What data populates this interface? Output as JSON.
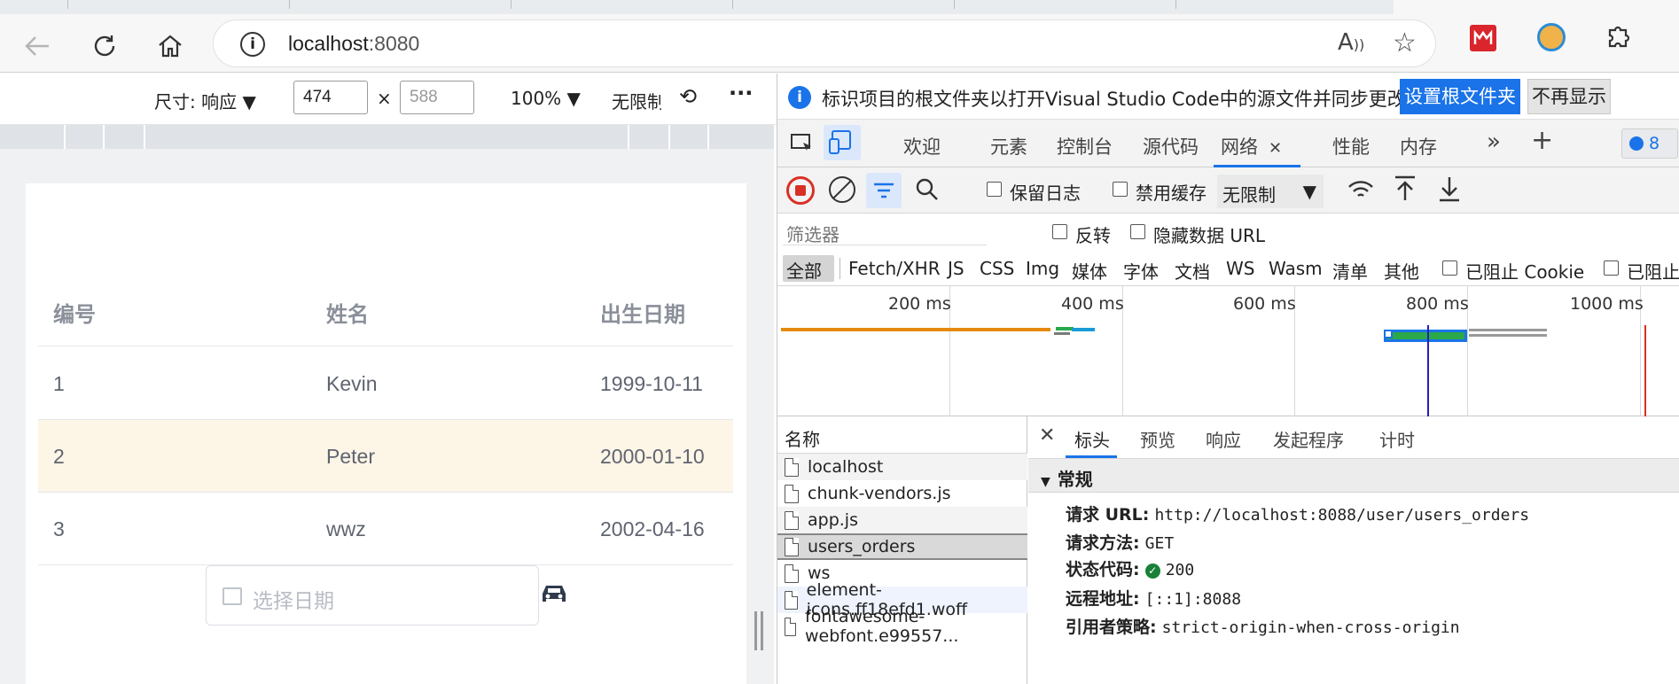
{
  "browser": {
    "url_host": "localhost",
    "url_port": ":8080",
    "icons": [
      "back-icon",
      "refresh-icon",
      "home-icon",
      "info-icon",
      "read-aloud-icon",
      "favorite-icon",
      "extension-icons"
    ]
  },
  "emulation": {
    "dimensions_label": "尺寸: 响应",
    "width_value": "474",
    "times": "×",
    "height_placeholder": "588",
    "zoom": "100%",
    "throttle": "无限制",
    "more": "···"
  },
  "table": {
    "headers": [
      "编号",
      "姓名",
      "出生日期"
    ],
    "rows": [
      {
        "id": "1",
        "name": "Kevin",
        "date": "1999-10-11"
      },
      {
        "id": "2",
        "name": "Peter",
        "date": "2000-01-10"
      },
      {
        "id": "3",
        "name": "wwz",
        "date": "2002-04-16"
      }
    ],
    "date_placeholder": "选择日期"
  },
  "devtools": {
    "info_message": "标识项目的根文件夹以打开Visual Studio Code中的源文件并同步更改。",
    "set_root_button": "设置根文件夹",
    "dismiss_button": "不再显示",
    "tabs": [
      "欢迎",
      "元素",
      "控制台",
      "源代码",
      "网络",
      "性能",
      "内存"
    ],
    "active_tab": "网络",
    "issues_count": "8",
    "preserve_log": "保留日志",
    "disable_cache": "禁用缓存",
    "throttle": "无限制",
    "filter_placeholder": "筛选器",
    "invert": "反转",
    "hide_data_urls": "隐藏数据 URL",
    "type_filters": [
      "全部",
      "Fetch/XHR",
      "JS",
      "CSS",
      "Img",
      "媒体",
      "字体",
      "文档",
      "WS",
      "Wasm",
      "清单",
      "其他"
    ],
    "blocked_cookies": "已阻止 Cookie",
    "blocked_requests": "已阻止",
    "timeline_ticks": [
      "200 ms",
      "400 ms",
      "600 ms",
      "800 ms",
      "1000 ms"
    ],
    "name_header": "名称",
    "requests": [
      "localhost",
      "chunk-vendors.js",
      "app.js",
      "users_orders",
      "ws",
      "element-icons.ff18efd1.woff",
      "fontawesome-webfont.e99557..."
    ],
    "selected_request": "users_orders",
    "detail_tabs": [
      "标头",
      "预览",
      "响应",
      "发起程序",
      "计时"
    ],
    "section_title": "常规",
    "general": {
      "url_label": "请求 URL:",
      "url_value": "http://localhost:8088/user/users_orders",
      "method_label": "请求方法:",
      "method_value": "GET",
      "status_label": "状态代码:",
      "status_value": "200",
      "remote_label": "远程地址:",
      "remote_value": "[::1]:8088",
      "referrer_label": "引用者策略:",
      "referrer_value": "strict-origin-when-cross-origin"
    },
    "colors": {
      "accent": "#1a73e8",
      "record": "#d93025",
      "status_ok": "#188038"
    }
  }
}
